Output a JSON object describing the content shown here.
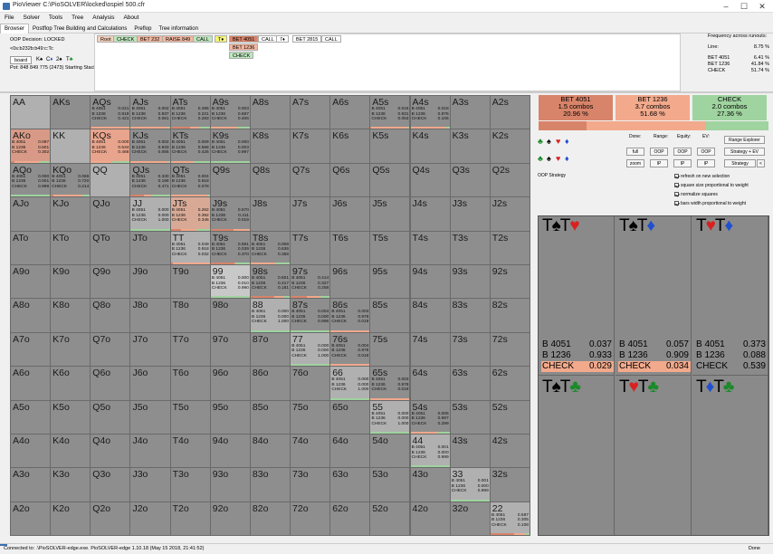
{
  "window": {
    "title": "PioViewer C:\\PioSOLVER\\locked\\ospiel 500.cfr"
  },
  "menu": [
    "File",
    "Solver",
    "Tools",
    "Tree",
    "Analysis",
    "About"
  ],
  "tabs": [
    {
      "label": "Browser",
      "active": true
    },
    {
      "label": "Postflop Tree Building and Calculations",
      "active": false
    },
    {
      "label": "Preflop",
      "active": false
    },
    {
      "label": "Tree information",
      "active": false
    }
  ],
  "info": {
    "decision": "OOP Decision:  LOCKED",
    "line": "<0s:b232b:b49:c:Tc",
    "board_btn": "board",
    "board_cards": [
      {
        "r": "K",
        "s": "♠",
        "cls": "suit-s"
      },
      {
        "r": "C",
        "s": "♦",
        "cls": "suit-d"
      },
      {
        "r": "2",
        "s": "♠",
        "cls": "suit-s"
      },
      {
        "r": "T",
        "s": "♣",
        "cls": "suit-c2"
      }
    ],
    "pot": "Pot: 848 849 775 (2473)  Starting Stacks 4"
  },
  "tree": {
    "row1": [
      {
        "label": "Root",
        "bg": "#f4d0bc"
      },
      {
        "label": "CHECK",
        "bg": "#bfe6bf"
      },
      {
        "label": "BET 232",
        "bg": "#f2b8a0"
      },
      {
        "label": "RAISE 849",
        "bg": "#f2b8a0"
      },
      {
        "label": "CALL",
        "bg": "#bfe6bf"
      },
      {
        "label": "T♦",
        "bg": "#f3f37a"
      },
      {
        "label": "BET 4051",
        "bg": "#d8846a"
      },
      {
        "label": "CALL",
        "bg": "#ffffff"
      },
      {
        "label": "7♦",
        "bg": "#ffffff"
      },
      {
        "label": "BET 2815",
        "bg": "#ffffff"
      },
      {
        "label": "CALL",
        "bg": "#ffffff"
      }
    ],
    "sub": [
      {
        "label": "BET 1236",
        "bg": "#f2b8a0"
      },
      {
        "label": "CHECK",
        "bg": "#bfe6bf"
      }
    ]
  },
  "freq": {
    "title": "Frequency across runouts:",
    "rows": [
      {
        "label": "Line:",
        "value": "8.75 %"
      },
      {
        "label": "BET 4051",
        "value": "6.41 %"
      },
      {
        "label": "BET 1236",
        "value": "41.84 %"
      },
      {
        "label": "CHECK",
        "value": "51.74 %"
      }
    ]
  },
  "actions": [
    {
      "label": "BET 4051",
      "combos": "1.5 combos",
      "pct": "20.96 %",
      "freq": 20.96,
      "color": "#d8846a"
    },
    {
      "label": "BET 1236",
      "combos": "3.7 combos",
      "pct": "51.68 %",
      "freq": 51.68,
      "color": "#f2a98c"
    },
    {
      "label": "CHECK",
      "combos": "2.0 combos",
      "pct": "27.36 %",
      "freq": 27.36,
      "color": "#9fd39f"
    }
  ],
  "controls": {
    "done": "Done:",
    "range": "Range:",
    "equity": "Equity:",
    "ev": "EV:",
    "full": "full",
    "zoom": "zoom",
    "oop1": "OOP",
    "ip1": "IP",
    "oop2": "OOP",
    "ip2": "IP",
    "oop3": "OOP",
    "ip3": "IP",
    "range_explorer": "Range Explorer",
    "strategy_ev": "Strategy + EV",
    "strategy": "Strategy",
    "back": "<",
    "oop_strategy": "OOP Strategy",
    "checks": [
      "refresh on new selection",
      "square size proportional to weight",
      "normalize squares",
      "bars width proportional to weight"
    ]
  },
  "grid": {
    "ranks": [
      "A",
      "K",
      "Q",
      "J",
      "T",
      "9",
      "8",
      "7",
      "6",
      "5",
      "4",
      "3",
      "2"
    ],
    "stats": {
      "AQs": [
        [
          "B 4051",
          "0.021"
        ],
        [
          "B 1236",
          "0.919"
        ],
        [
          "CHECK",
          "0.421"
        ]
      ],
      "AJs": [
        [
          "B 4051",
          "0.002"
        ],
        [
          "B 1236",
          "0.937"
        ],
        [
          "CHECK",
          "0.061"
        ]
      ],
      "ATs": [
        [
          "B 4051",
          "0.496"
        ],
        [
          "B 1236",
          "0.221"
        ],
        [
          "CHECK",
          "0.283"
        ]
      ],
      "A9s": [
        [
          "B 4051",
          "0.003"
        ],
        [
          "B 1236",
          "0.687"
        ],
        [
          "CHECK",
          "0.406"
        ]
      ],
      "A5s": [
        [
          "B 4051",
          "0.016"
        ],
        [
          "B 1236",
          "0.931"
        ],
        [
          "CHECK",
          "0.053"
        ]
      ],
      "A4s": [
        [
          "B 4051",
          "0.018"
        ],
        [
          "B 1236",
          "0.876"
        ],
        [
          "CHECK",
          "0.106"
        ]
      ],
      "AKo": [
        [
          "B 4051",
          "0.097"
        ],
        [
          "B 1236",
          "0.601"
        ],
        [
          "CHECK",
          "0.302"
        ]
      ],
      "KQs": [
        [
          "B 4051",
          "0.000"
        ],
        [
          "B 1236",
          "0.534"
        ],
        [
          "CHECK",
          "0.466"
        ]
      ],
      "KJs": [
        [
          "B 4051",
          "0.002"
        ],
        [
          "B 1236",
          "0.933"
        ],
        [
          "CHECK",
          "0.065"
        ]
      ],
      "KTs": [
        [
          "B 4051",
          "0.009"
        ],
        [
          "B 1236",
          "0.568"
        ],
        [
          "CHECK",
          "0.426"
        ]
      ],
      "K9s": [
        [
          "B 4051",
          "0.000"
        ],
        [
          "B 1236",
          "0.003"
        ],
        [
          "CHECK",
          "0.997"
        ]
      ],
      "AQo": [
        [
          "B 4051",
          "0.000"
        ],
        [
          "B 1236",
          "0.001"
        ],
        [
          "CHECK",
          "0.999"
        ]
      ],
      "KQo": [
        [
          "B 4051",
          "0.066"
        ],
        [
          "B 1236",
          "0.720"
        ],
        [
          "CHECK",
          "0.214"
        ]
      ],
      "QJs": [
        [
          "B 4051",
          "0.330"
        ],
        [
          "B 1236",
          "0.199"
        ],
        [
          "CHECK",
          "0.471"
        ]
      ],
      "QTs": [
        [
          "B 4051",
          "0.004"
        ],
        [
          "B 1236",
          "0.918"
        ],
        [
          "CHECK",
          "0.078"
        ]
      ],
      "JJ": [
        [
          "B 4051",
          "0.000"
        ],
        [
          "B 1236",
          "0.000"
        ],
        [
          "CHECK",
          "1.000"
        ]
      ],
      "JTs": [
        [
          "B 4051",
          "0.262"
        ],
        [
          "B 1236",
          "0.392"
        ],
        [
          "CHECK",
          "0.346"
        ]
      ],
      "J9s": [
        [
          "B 4051",
          "0.570"
        ],
        [
          "B 1236",
          "0.411"
        ],
        [
          "CHECK",
          "0.019"
        ]
      ],
      "TT": [
        [
          "B 4051",
          "0.049"
        ],
        [
          "B 1236",
          "0.918"
        ],
        [
          "CHECK",
          "0.032"
        ]
      ],
      "T9s": [
        [
          "B 4051",
          "0.591"
        ],
        [
          "B 1236",
          "0.039"
        ],
        [
          "CHECK",
          "0.370"
        ]
      ],
      "T8s": [
        [
          "B 4051",
          "0.008"
        ],
        [
          "B 1236",
          "0.636"
        ],
        [
          "CHECK",
          "0.356"
        ]
      ],
      "99": [
        [
          "B 4051",
          "0.000"
        ],
        [
          "B 1236",
          "0.010"
        ],
        [
          "CHECK",
          "0.990"
        ]
      ],
      "98s": [
        [
          "B 4051",
          "0.601"
        ],
        [
          "B 1236",
          "0.217"
        ],
        [
          "CHECK",
          "0.181"
        ]
      ],
      "97s": [
        [
          "B 4051",
          "0.414"
        ],
        [
          "B 1236",
          "0.327"
        ],
        [
          "CHECK",
          "0.258"
        ]
      ],
      "88": [
        [
          "B 4051",
          "0.000"
        ],
        [
          "B 1236",
          "0.000"
        ],
        [
          "CHECK",
          "1.000"
        ]
      ],
      "87s": [
        [
          "B 4051",
          "0.004"
        ],
        [
          "B 1236",
          "0.000"
        ],
        [
          "CHECK",
          "0.996"
        ]
      ],
      "86s": [
        [
          "B 4051",
          "0.003"
        ],
        [
          "B 1236",
          "0.978"
        ],
        [
          "CHECK",
          "0.019"
        ]
      ],
      "77": [
        [
          "B 4051",
          "0.000"
        ],
        [
          "B 1236",
          "0.000"
        ],
        [
          "CHECK",
          "1.000"
        ]
      ],
      "76s": [
        [
          "B 4051",
          "0.004"
        ],
        [
          "B 1236",
          "0.978"
        ],
        [
          "CHECK",
          "0.019"
        ]
      ],
      "66": [
        [
          "B 4051",
          "0.000"
        ],
        [
          "B 1236",
          "0.000"
        ],
        [
          "CHECK",
          "1.000"
        ]
      ],
      "65s": [
        [
          "B 4051",
          "0.003"
        ],
        [
          "B 1236",
          "0.978"
        ],
        [
          "CHECK",
          "0.019"
        ]
      ],
      "55": [
        [
          "B 4051",
          "0.000"
        ],
        [
          "B 1236",
          "0.000"
        ],
        [
          "CHECK",
          "1.000"
        ]
      ],
      "54s": [
        [
          "B 4051",
          "0.005"
        ],
        [
          "B 1236",
          "0.697"
        ],
        [
          "CHECK",
          "0.299"
        ]
      ],
      "44": [
        [
          "B 4051",
          "0.001"
        ],
        [
          "B 1236",
          "0.000"
        ],
        [
          "CHECK",
          "0.999"
        ]
      ],
      "33": [
        [
          "B 4051",
          "0.001"
        ],
        [
          "B 1236",
          "0.000"
        ],
        [
          "CHECK",
          "0.999"
        ]
      ],
      "22": [
        [
          "B 4051",
          "0.587"
        ],
        [
          "B 1236",
          "0.305"
        ],
        [
          "CHECK",
          "0.108"
        ]
      ]
    },
    "highlight": {
      "KQs": "#e8a48c",
      "AKo": "#d89a86",
      "JTs": "#d8aa96",
      "99": "#c8c8c8",
      "QQ": "#b0b0b0"
    }
  },
  "suits": [
    {
      "title": [
        {
          "r": "T",
          "s": "♠",
          "cls": "suit-s"
        },
        {
          "r": "T",
          "s": "♥",
          "cls": "suit-h"
        }
      ],
      "stats": [
        [
          "B 4051",
          "0.037"
        ],
        [
          "B 1236",
          "0.933"
        ],
        [
          "CHECK",
          "0.029"
        ]
      ],
      "title2": [
        {
          "r": "T",
          "s": "♠",
          "cls": "suit-s"
        },
        {
          "r": "T",
          "s": "♣",
          "cls": "suit-c2"
        }
      ]
    },
    {
      "title": [
        {
          "r": "T",
          "s": "♠",
          "cls": "suit-s"
        },
        {
          "r": "T",
          "s": "♦",
          "cls": "suit-d"
        }
      ],
      "stats": [
        [
          "B 4051",
          "0.057"
        ],
        [
          "B 1236",
          "0.909"
        ],
        [
          "CHECK",
          "0.034"
        ]
      ],
      "title2": [
        {
          "r": "T",
          "s": "♥",
          "cls": "suit-h"
        },
        {
          "r": "T",
          "s": "♣",
          "cls": "suit-c2"
        }
      ]
    },
    {
      "title": [
        {
          "r": "T",
          "s": "♥",
          "cls": "suit-h"
        },
        {
          "r": "T",
          "s": "♦",
          "cls": "suit-d"
        }
      ],
      "stats": [
        [
          "B 4051",
          "0.373"
        ],
        [
          "B 1236",
          "0.088"
        ],
        [
          "CHECK",
          "0.539"
        ]
      ],
      "title2": [
        {
          "r": "T",
          "s": "♦",
          "cls": "suit-d"
        },
        {
          "r": "T",
          "s": "♣",
          "cls": "suit-c2"
        }
      ]
    }
  ],
  "status": {
    "left": "Connected to: .\\PioSOLVER-edge.exe. PioSOLVER-edge 1.10.18 (May 15 2018, 21:41:52)",
    "right": "Done"
  }
}
